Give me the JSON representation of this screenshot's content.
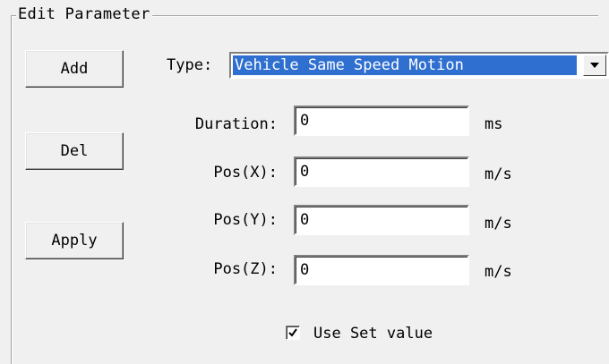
{
  "group": {
    "title": "Edit Parameter"
  },
  "buttons": {
    "add": "Add",
    "del": "Del",
    "apply": "Apply"
  },
  "type_field": {
    "label": "Type:",
    "selected": "Vehicle Same Speed Motion"
  },
  "fields": [
    {
      "label": "Duration:",
      "value": "0",
      "unit": "ms"
    },
    {
      "label": "Pos(X):",
      "value": "0",
      "unit": "m/s"
    },
    {
      "label": "Pos(Y):",
      "value": "0",
      "unit": "m/s"
    },
    {
      "label": "Pos(Z):",
      "value": "0",
      "unit": "m/s"
    }
  ],
  "use_set_value": {
    "label": "Use Set value",
    "checked": true
  },
  "icons": {
    "dropdown": "chevron-down-icon",
    "check": "check-icon"
  }
}
